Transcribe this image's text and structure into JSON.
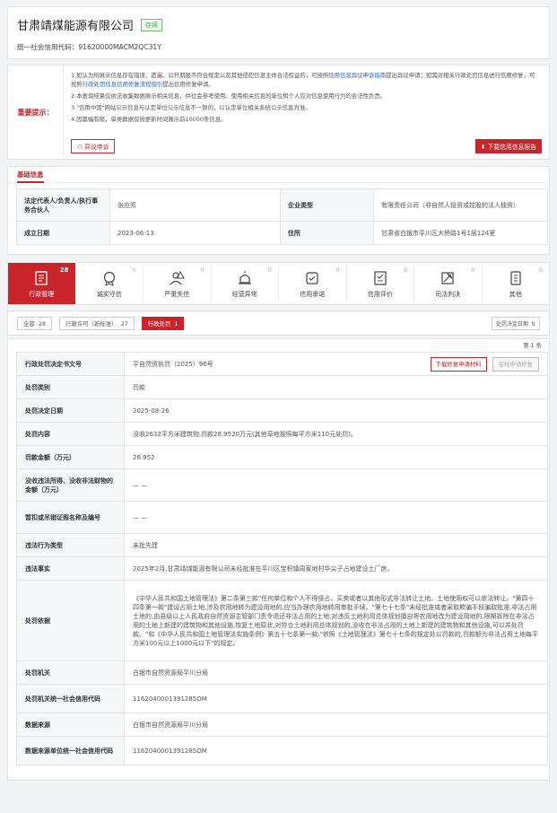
{
  "header": {
    "company_name": "甘肃靖煤能源有限公司",
    "status": "存续",
    "credit_code": "统一社会信用代码：91620000MACM2QC31Y"
  },
  "tips": {
    "label": "重要提示：",
    "items": [
      {
        "pre": "1.如认为所展示信息存在错误、遗漏、公开期限不符合规定以及其他侵犯信息主体合法权益的，可按照",
        "link": "信用信息异议申诉指南",
        "post": "提出异议申请；如需对相关行政处罚信息进行信用修复，可按照",
        "link2": "行政处罚信息信用修复流程指引",
        "post2": "提出信用修复申请。"
      },
      {
        "pre": "2.本查询结果仅依法收集数据展示相关信息，供社会参考使用。使用相关信息的单位和个人应对信息使用行为的合法性负责。",
        "link": "",
        "post": "",
        "link2": "",
        "post2": ""
      },
      {
        "pre": "3.\"信用中国\"网站公示信息与认定单位公示信息不一致的，以认定单位相关系统公示信息为准。",
        "link": "",
        "post": "",
        "link2": "",
        "post2": ""
      },
      {
        "pre": "4.因篇幅有限，单类数据仅按更新时间展示前10000条信息。",
        "link": "",
        "post": "",
        "link2": "",
        "post2": ""
      }
    ],
    "appeal_button": "异议申诉",
    "report_button": "下载信用信息报告"
  },
  "basic": {
    "section_title": "基础信息",
    "rows": [
      {
        "k1": "法定代表人/负责人/执行事务合伙人",
        "v1": "张应芳",
        "k2": "企业类型",
        "v2": "有限责任公司（非自然人投资或控股的法人独资）"
      },
      {
        "k1": "成立日期",
        "v1": "2023-06-13",
        "k2": "住所",
        "v2": "甘肃省白银市平川区大桥路1号1层124室"
      }
    ]
  },
  "tabs": [
    {
      "label": "行政管理",
      "count": "28",
      "icon": "document-icon"
    },
    {
      "label": "诚实守信",
      "count": "0",
      "icon": "badge-icon"
    },
    {
      "label": "严重失信",
      "count": "0",
      "icon": "warning-person-icon"
    },
    {
      "label": "经营异常",
      "count": "0",
      "icon": "alarm-icon"
    },
    {
      "label": "信用承诺",
      "count": "0",
      "icon": "pledge-icon"
    },
    {
      "label": "信用评价",
      "count": "0",
      "icon": "evaluation-icon"
    },
    {
      "label": "司法判决",
      "count": "0",
      "icon": "gavel-icon"
    },
    {
      "label": "其他",
      "count": "0",
      "icon": "more-icon"
    }
  ],
  "filters": {
    "chips": [
      {
        "label": "全部",
        "count": "28"
      },
      {
        "label": "行政许可（新标准）",
        "count": "27"
      },
      {
        "label": "行政处罚",
        "count": "1"
      }
    ],
    "sort_label": "处罚决定日期"
  },
  "detail": {
    "count_text": "第 1 条",
    "download_button": "下载修复申请材料",
    "repair_button": "在线申请修复",
    "rows": [
      {
        "k": "行政处罚决定书文号",
        "v": "平自然资执罚（2025）96号"
      },
      {
        "k": "处罚类别",
        "v": "罚款"
      },
      {
        "k": "处罚决定日期",
        "v": "2025-08-26"
      },
      {
        "k": "处罚内容",
        "v": "没收2632平方米建筑物,罚款28.9520万元(其他草地按照每平方米110元处罚)。"
      },
      {
        "k": "罚款金额（万元）",
        "v": "28.952"
      },
      {
        "k": "没收违法所得、没收非法财物的金额（万元）",
        "v": "— —"
      },
      {
        "k": "暂扣或吊销证照名称及编号",
        "v": "— —"
      },
      {
        "k": "违法行为类型",
        "v": "未批先建"
      },
      {
        "k": "违法事实",
        "v": "2025年2月,甘肃靖煤能源有限公司未经批准在平川区宝积镇周家地村华尖子占地建设土厂房。"
      },
      {
        "k": "处罚依据",
        "v": "《中华人民共和国土地管理法》第二条第三款\"任何单位和个人不得侵占、买卖或者以其他形式非法转让土地。土地使用权可以依法转让。\"第四十四条第一款\"建设占用土地,涉及农用地转为建设用地的,应当办理农用地转用审批手续。\"第七十七条\"未经批准或者采取欺骗手段骗取批准,非法占用土地的,由县级以上人民政府自然资源主管部门责令退还非法占用的土地,对违反土地利用总体规划擅自将农用地改为建设用地的,限期拆除在非法占用的土地上新建的建筑物和其他设施,恢复土地原状,对符合土地利用总体规划的,没收在非法占用的土地上新建的建筑物和其他设施,可以并处罚款。\"和《中华人民共和国土地管理法实施条例》第五十七条第一款:\"依照《土地管理法》第七十七条的规定处以罚款的,罚款额为非法占用土地每平方米100元以上1000元以下\"的规定。"
      },
      {
        "k": "处罚机关",
        "v": "白银市自然资源局平川分局"
      },
      {
        "k": "处罚机关统一社会信用代码",
        "v": "1162040001391285OM"
      },
      {
        "k": "数据来源",
        "v": "白银市自然资源局平川分局"
      },
      {
        "k": "数据来源单位统一社会信用代码",
        "v": "1162040001391285OM"
      }
    ]
  },
  "colors": {
    "accent": "#c8242a",
    "status_green": "#4caf50",
    "link": "#2a62c9"
  }
}
